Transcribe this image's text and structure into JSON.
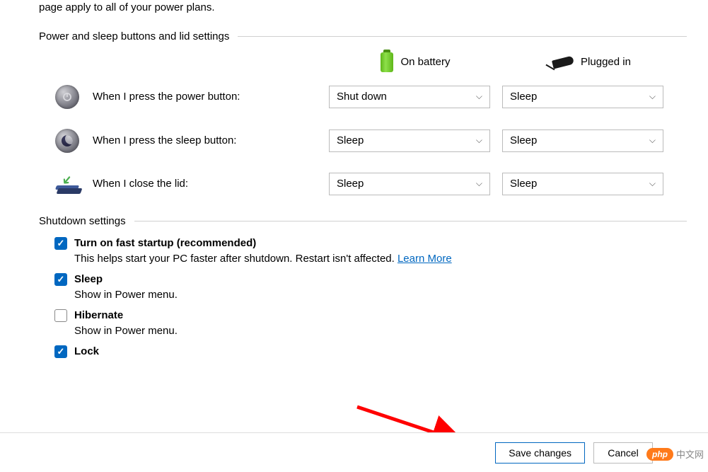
{
  "intro_fragment": "page apply to all of your power plans.",
  "sections": {
    "buttons_lid": "Power and sleep buttons and lid settings",
    "shutdown": "Shutdown settings"
  },
  "columns": {
    "battery": "On battery",
    "plugged": "Plugged in"
  },
  "rows": {
    "power": {
      "label": "When I press the power button:",
      "battery": "Shut down",
      "plugged": "Sleep"
    },
    "sleep": {
      "label": "When I press the sleep button:",
      "battery": "Sleep",
      "plugged": "Sleep"
    },
    "lid": {
      "label": "When I close the lid:",
      "battery": "Sleep",
      "plugged": "Sleep"
    }
  },
  "shutdown_options": {
    "fast_startup": {
      "checked": true,
      "label": "Turn on fast startup (recommended)",
      "desc": "This helps start your PC faster after shutdown. Restart isn't affected. ",
      "link": "Learn More"
    },
    "sleep": {
      "checked": true,
      "label": "Sleep",
      "desc": "Show in Power menu."
    },
    "hibernate": {
      "checked": false,
      "label": "Hibernate",
      "desc": "Show in Power menu."
    },
    "lock": {
      "checked": true,
      "label": "Lock"
    }
  },
  "footer": {
    "save": "Save changes",
    "cancel": "Cancel"
  },
  "watermark": {
    "brand": "php",
    "text": "中文网"
  }
}
